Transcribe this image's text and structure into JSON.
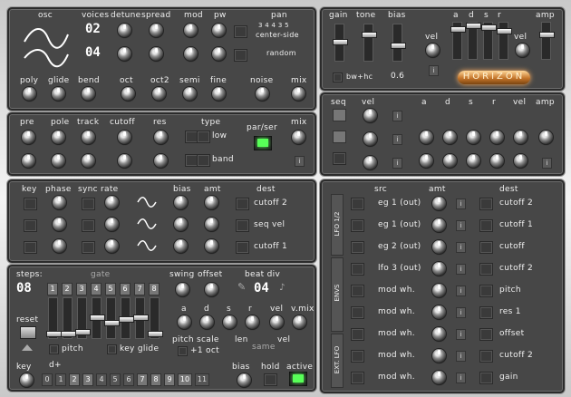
{
  "osc": {
    "labels": {
      "osc": "osc",
      "voices": "voices",
      "detune": "detune",
      "spread": "spread",
      "mod": "mod",
      "pw": "pw",
      "pan": "pan"
    },
    "voices_value": "02",
    "voices_value2": "04",
    "pan_mode": "center-side",
    "pan_random": "random",
    "pan_digits": "3  4  4 3 5",
    "row2": {
      "poly": "poly",
      "glide": "glide",
      "bend": "bend",
      "oct": "oct",
      "oct2": "oct2",
      "semi": "semi",
      "fine": "fine",
      "noise": "noise",
      "mix": "mix"
    }
  },
  "amp_panel": {
    "gain": "gain",
    "tone": "tone",
    "bias": "bias",
    "vel": "vel",
    "a": "a",
    "d": "d",
    "s": "s",
    "r": "r",
    "amp": "amp",
    "bwhc": "bw+hc",
    "value": "0.6",
    "logo": "HORIZON"
  },
  "filter": {
    "pre": "pre",
    "pole": "pole",
    "track": "track",
    "cutoff": "cutoff",
    "res": "res",
    "type": "type",
    "low": "low",
    "band": "band",
    "parser": "par/ser",
    "mix": "mix"
  },
  "seq_env": {
    "seq": "seq",
    "vel": "vel",
    "a": "a",
    "d": "d",
    "s": "s",
    "r": "r",
    "vel2": "vel",
    "amp": "amp"
  },
  "lfo": {
    "key": "key",
    "phase": "phase",
    "sync": "sync",
    "rate": "rate",
    "bias": "bias",
    "amt": "amt",
    "dest": "dest",
    "dest_values": [
      "cutoff 2",
      "seq vel",
      "cutoff 1"
    ]
  },
  "mod_matrix": {
    "headers": {
      "src": "src",
      "amt": "amt",
      "dest": "dest"
    },
    "side_labels": [
      "LFO 1/2",
      "ENVS",
      "EXT. LFO"
    ],
    "rows": [
      {
        "src": "eg 1 (out)",
        "dest": "cutoff 2"
      },
      {
        "src": "eg 1 (out)",
        "dest": "cutoff 1"
      },
      {
        "src": "eg 2 (out)",
        "dest": "cutoff"
      },
      {
        "src": "lfo 3 (out)",
        "dest": "cutoff 2"
      },
      {
        "src": "mod wh.",
        "dest": "pitch"
      },
      {
        "src": "mod wh.",
        "dest": "res 1"
      },
      {
        "src": "mod wh.",
        "dest": "offset"
      },
      {
        "src": "mod wh.",
        "dest": "cutoff 2"
      },
      {
        "src": "mod wh.",
        "dest": "gain"
      }
    ]
  },
  "seq": {
    "steps": "steps:",
    "steps_value": "08",
    "gate": "gate",
    "swing": "swing",
    "offset": "offset",
    "beat_div": "beat div",
    "beat_value": "04",
    "step_numbers": [
      "1",
      "2",
      "3",
      "4",
      "5",
      "6",
      "7",
      "8"
    ],
    "reset": "reset",
    "pitch": "pitch",
    "key_glide": "key glide",
    "pitch_scale": "pitch scale",
    "oct": "+1 oct",
    "a": "a",
    "d": "d",
    "s": "s",
    "r": "r",
    "vel": "vel",
    "vmix": "v.mix",
    "len": "len",
    "same": "same",
    "vel2": "vel",
    "key": "key",
    "dplus": "d+",
    "bias": "bias",
    "hold": "hold",
    "active": "active",
    "key_numbers": [
      "0",
      "1",
      "2",
      "3",
      "4",
      "5",
      "6",
      "7",
      "8",
      "9",
      "10",
      "11"
    ]
  }
}
